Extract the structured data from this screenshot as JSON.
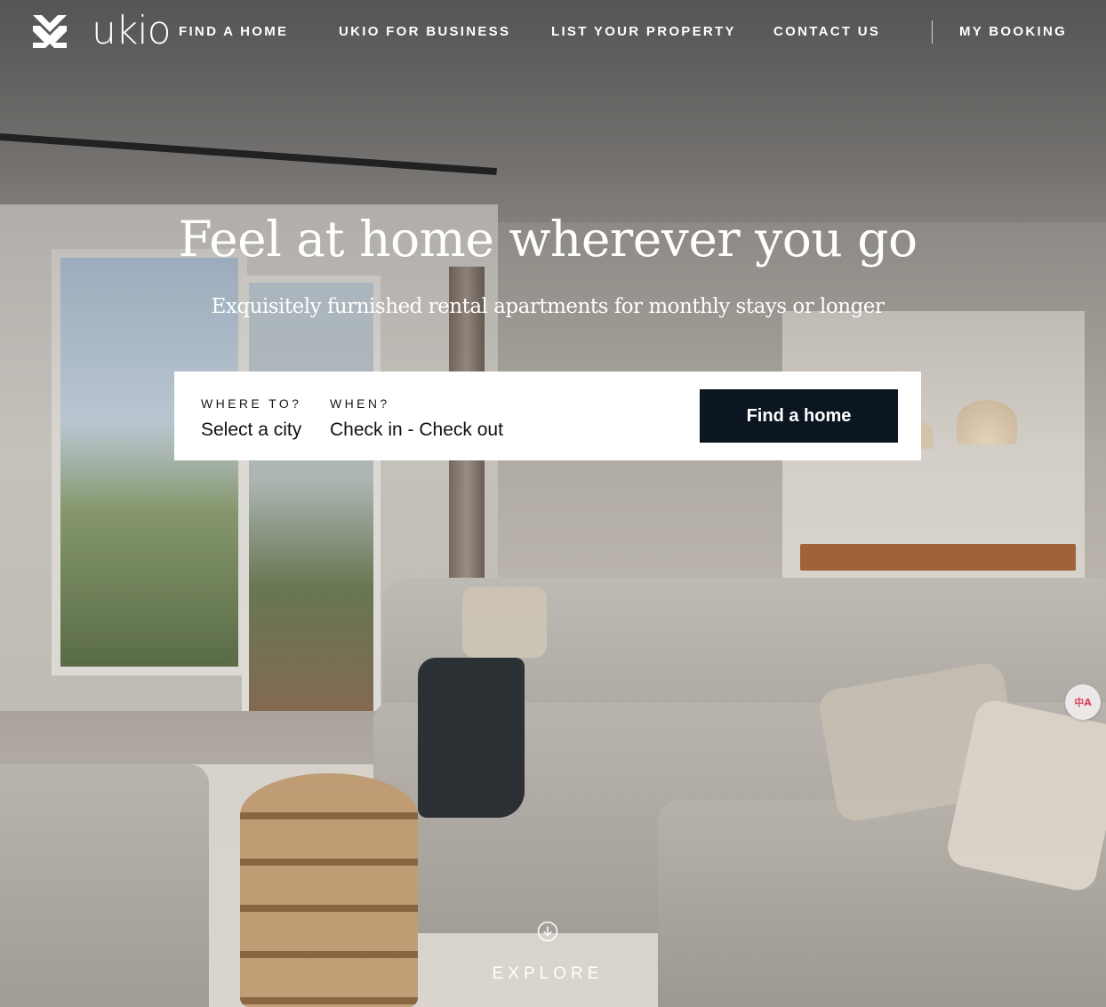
{
  "brand": {
    "name": "ukio",
    "logo_icon": "ukio-logo-mark"
  },
  "nav": {
    "items": [
      {
        "label": "FIND A HOME"
      },
      {
        "label": "UKIO FOR BUSINESS"
      },
      {
        "label": "LIST YOUR PROPERTY"
      },
      {
        "label": "CONTACT US"
      }
    ],
    "my_booking": "MY BOOKING"
  },
  "hero": {
    "title": "Feel at home wherever you go",
    "subtitle": "Exquisitely furnished rental apartments for monthly stays or longer"
  },
  "search": {
    "where_label": "WHERE TO?",
    "where_value": "Select a city",
    "when_label": "WHEN?",
    "when_value": "Check in - Check out",
    "button_label": "Find a home"
  },
  "explore": {
    "label": "EXPLORE",
    "icon": "arrow-down-circle-icon"
  },
  "translate_widget": {
    "glyph": "中A",
    "icon": "translate-icon"
  },
  "colors": {
    "button_bg": "#0c1621",
    "text_light": "#ffffff"
  }
}
